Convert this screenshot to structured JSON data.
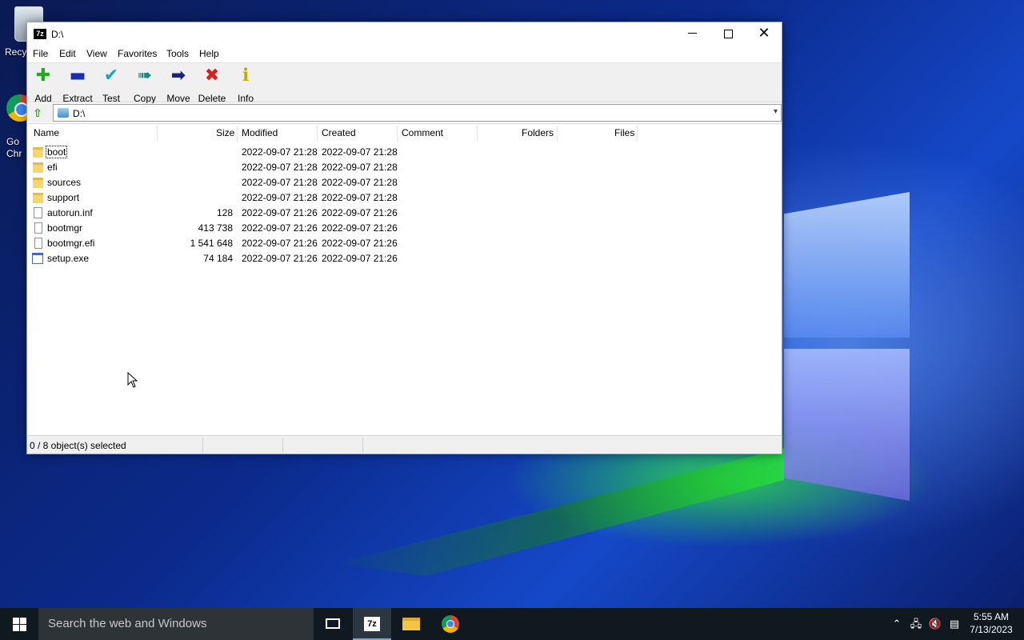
{
  "desktop": {
    "icons": [
      {
        "label": "Recy"
      },
      {
        "label": "Go\nChr"
      }
    ]
  },
  "window": {
    "title": "D:\\",
    "app_icon": "7z",
    "controls": {
      "minimize": "minimize-icon",
      "maximize": "maximize-icon",
      "close": "close-icon"
    }
  },
  "menu": [
    "File",
    "Edit",
    "View",
    "Favorites",
    "Tools",
    "Help"
  ],
  "toolbar": [
    {
      "label": "Add",
      "icon": "plus-icon",
      "color": "#22aa22"
    },
    {
      "label": "Extract",
      "icon": "minus-icon",
      "color": "#1a2fb0"
    },
    {
      "label": "Test",
      "icon": "check-icon",
      "color": "#1aa6b8"
    },
    {
      "label": "Copy",
      "icon": "double-arrow-icon",
      "color": "#1c8a8a"
    },
    {
      "label": "Move",
      "icon": "arrow-right-icon",
      "color": "#1a237e"
    },
    {
      "label": "Delete",
      "icon": "x-icon",
      "color": "#d62020"
    },
    {
      "label": "Info",
      "icon": "info-icon",
      "color": "#c9a800"
    }
  ],
  "address": {
    "path": "D:\\"
  },
  "columns": [
    "Name",
    "Size",
    "Modified",
    "Created",
    "Comment",
    "Folders",
    "Files"
  ],
  "files": [
    {
      "name": "boot",
      "type": "folder",
      "size": "",
      "modified": "2022-09-07 21:28",
      "created": "2022-09-07 21:28"
    },
    {
      "name": "efi",
      "type": "folder",
      "size": "",
      "modified": "2022-09-07 21:28",
      "created": "2022-09-07 21:28"
    },
    {
      "name": "sources",
      "type": "folder",
      "size": "",
      "modified": "2022-09-07 21:28",
      "created": "2022-09-07 21:28"
    },
    {
      "name": "support",
      "type": "folder",
      "size": "",
      "modified": "2022-09-07 21:28",
      "created": "2022-09-07 21:28"
    },
    {
      "name": "autorun.inf",
      "type": "inf",
      "size": "128",
      "modified": "2022-09-07 21:26",
      "created": "2022-09-07 21:26"
    },
    {
      "name": "bootmgr",
      "type": "file",
      "size": "413 738",
      "modified": "2022-09-07 21:26",
      "created": "2022-09-07 21:26"
    },
    {
      "name": "bootmgr.efi",
      "type": "file",
      "size": "1 541 648",
      "modified": "2022-09-07 21:26",
      "created": "2022-09-07 21:26"
    },
    {
      "name": "setup.exe",
      "type": "exe",
      "size": "74 184",
      "modified": "2022-09-07 21:26",
      "created": "2022-09-07 21:26"
    }
  ],
  "status": {
    "text": "0 / 8 object(s) selected"
  },
  "taskbar": {
    "search_placeholder": "Search the web and Windows",
    "apps": [
      "task-view-icon",
      "7zip-icon",
      "file-explorer-icon",
      "chrome-icon"
    ],
    "time": "5:55 AM",
    "date": "7/13/2023"
  }
}
